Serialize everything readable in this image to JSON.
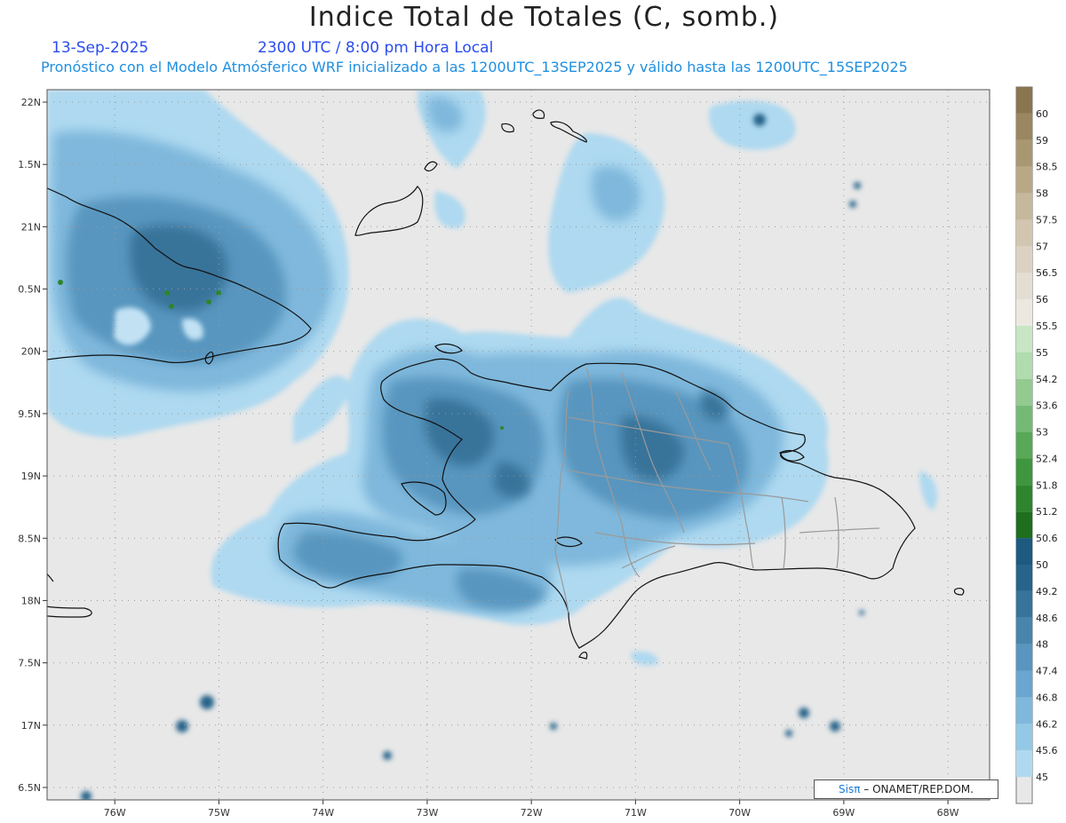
{
  "title": "Indice Total de Totales (C, somb.)",
  "date": "13-Sep-2025",
  "time": "2300 UTC / 8:00 pm Hora Local",
  "forecast": "Pronóstico con el Modelo Atmósferico WRF inicializado a las 1200UTC_13SEP2025 y válido hasta las  1200UTC_15SEP2025",
  "credit": {
    "logo": "Sisπ",
    "text": " – ONAMET/REP.DOM."
  },
  "map": {
    "lon_range": [
      -76.65,
      -67.6
    ],
    "lat_range": [
      16.4,
      22.1
    ],
    "lat_ticks": [
      {
        "v": 22,
        "l": "22N"
      },
      {
        "v": 21.5,
        "l": "1.5N"
      },
      {
        "v": 21,
        "l": "21N"
      },
      {
        "v": 20.5,
        "l": "0.5N"
      },
      {
        "v": 20,
        "l": "20N"
      },
      {
        "v": 19.5,
        "l": "9.5N"
      },
      {
        "v": 19,
        "l": "19N"
      },
      {
        "v": 18.5,
        "l": "8.5N"
      },
      {
        "v": 18,
        "l": "18N"
      },
      {
        "v": 17.5,
        "l": "7.5N"
      },
      {
        "v": 17,
        "l": "17N"
      },
      {
        "v": 16.5,
        "l": "6.5N"
      }
    ],
    "lon_ticks": [
      {
        "v": -76,
        "l": "76W"
      },
      {
        "v": -75,
        "l": "75W"
      },
      {
        "v": -74,
        "l": "74W"
      },
      {
        "v": -73,
        "l": "73W"
      },
      {
        "v": -72,
        "l": "72W"
      },
      {
        "v": -71,
        "l": "71W"
      },
      {
        "v": -70,
        "l": "70W"
      },
      {
        "v": -69,
        "l": "69W"
      },
      {
        "v": -68,
        "l": "68W"
      }
    ]
  },
  "legend": {
    "levels": [
      {
        "l": "45",
        "c": "#aed9f0"
      },
      {
        "l": "45.6",
        "c": "#93c9e6"
      },
      {
        "l": "46.2",
        "c": "#7fb8dc"
      },
      {
        "l": "46.8",
        "c": "#6aa6cf"
      },
      {
        "l": "47.4",
        "c": "#5896bf"
      },
      {
        "l": "48",
        "c": "#4785ad"
      },
      {
        "l": "48.6",
        "c": "#37739a"
      },
      {
        "l": "49.2",
        "c": "#27638a"
      },
      {
        "l": "50",
        "c": "#1c5a80"
      },
      {
        "l": "50.6",
        "c": "#1e6e1e"
      },
      {
        "l": "51.2",
        "c": "#2e852e"
      },
      {
        "l": "51.8",
        "c": "#3e963e"
      },
      {
        "l": "52.4",
        "c": "#58a858"
      },
      {
        "l": "53",
        "c": "#74ba74"
      },
      {
        "l": "53.6",
        "c": "#92ca90"
      },
      {
        "l": "54.2",
        "c": "#b0dcae"
      },
      {
        "l": "55",
        "c": "#c8e6c4"
      },
      {
        "l": "55.5",
        "c": "#ece8e0"
      },
      {
        "l": "56",
        "c": "#e4ded2"
      },
      {
        "l": "56.5",
        "c": "#dcd2c2"
      },
      {
        "l": "57",
        "c": "#d2c6b0"
      },
      {
        "l": "57.5",
        "c": "#c6b89c"
      },
      {
        "l": "58",
        "c": "#b8a886"
      },
      {
        "l": "58.5",
        "c": "#a99772"
      },
      {
        "l": "59",
        "c": "#9a8660"
      },
      {
        "l": "60",
        "c": "#8a7550"
      }
    ]
  }
}
